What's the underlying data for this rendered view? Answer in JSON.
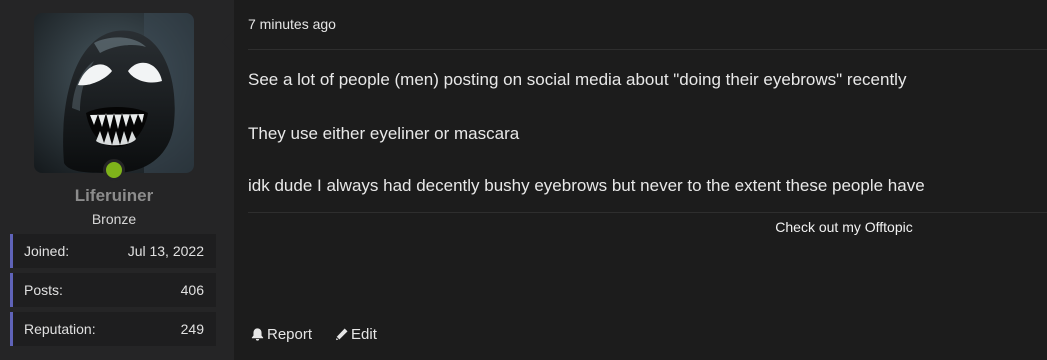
{
  "user": {
    "username": "Liferuiner",
    "title": "Bronze",
    "avatar": "venom-avatar",
    "online": true,
    "stats": [
      {
        "label": "Joined:",
        "value": "Jul 13, 2022"
      },
      {
        "label": "Posts:",
        "value": "406"
      },
      {
        "label": "Reputation:",
        "value": "249"
      }
    ]
  },
  "post": {
    "time": "7 minutes ago",
    "paragraphs": [
      "See a lot of people (men) posting on social media about \"doing their eyebrows\" recently",
      "They use either eyeliner or mascara",
      "idk dude I always had decently bushy eyebrows but never to the extent these people have"
    ],
    "signature": "Check out my Offtopic"
  },
  "actions": {
    "report_label": "Report",
    "edit_label": "Edit",
    "report_icon": "bell-icon",
    "edit_icon": "pencil-icon"
  },
  "colors": {
    "background": "#1c1c1c",
    "sidebar": "#252526",
    "stat_accent": "#5f63b8",
    "online": "#7fb31a"
  }
}
